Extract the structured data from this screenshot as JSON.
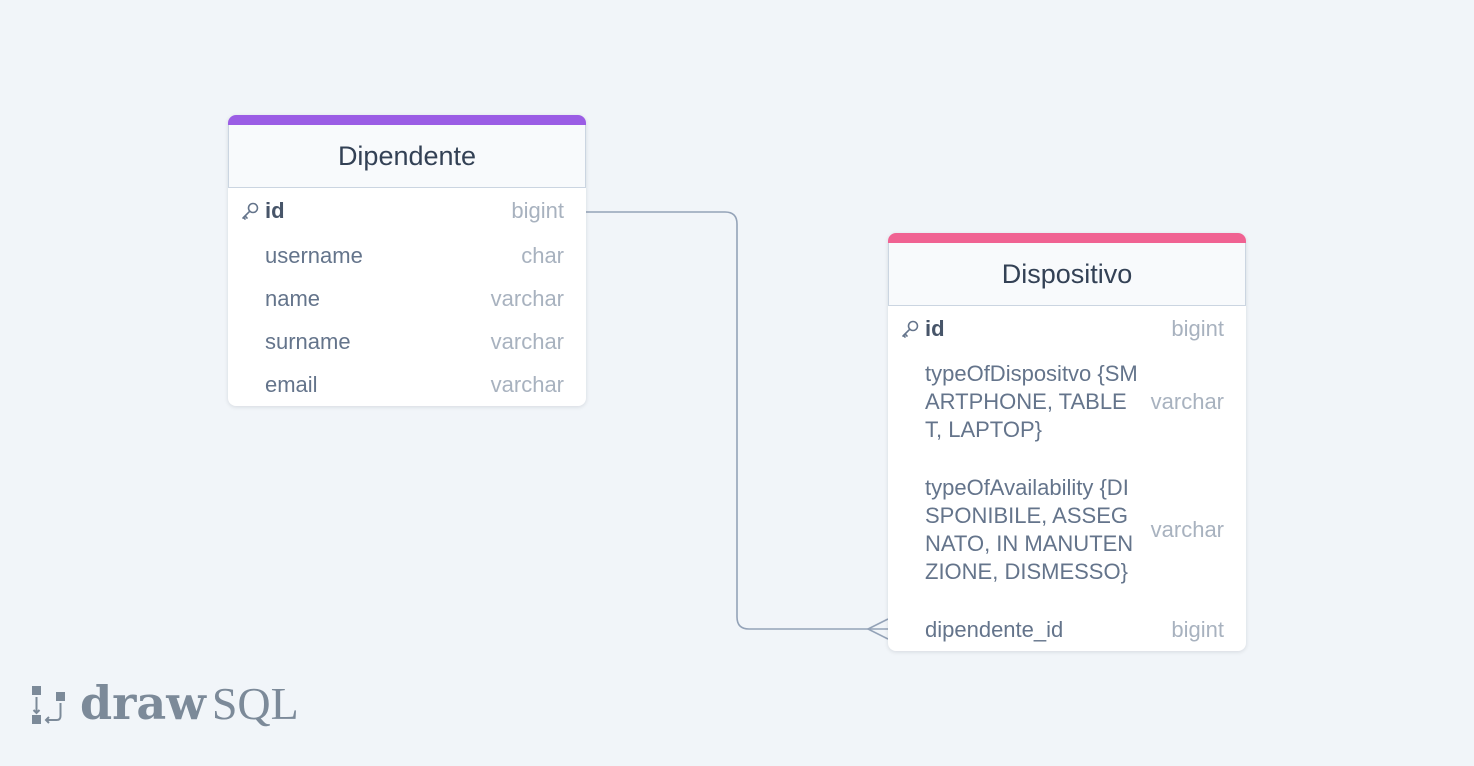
{
  "tables": [
    {
      "name": "Dipendente",
      "color": "#9b5de5",
      "columns": [
        {
          "name": "id",
          "type": "bigint",
          "primary_key": true
        },
        {
          "name": "username",
          "type": "char",
          "primary_key": false
        },
        {
          "name": "name",
          "type": "varchar",
          "primary_key": false
        },
        {
          "name": "surname",
          "type": "varchar",
          "primary_key": false
        },
        {
          "name": "email",
          "type": "varchar",
          "primary_key": false
        }
      ]
    },
    {
      "name": "Dispositivo",
      "color": "#f06292",
      "columns": [
        {
          "name": "id",
          "type": "bigint",
          "primary_key": true
        },
        {
          "name": "typeOfDispositvo {SMARTPHONE, TABLET, LAPTOP}",
          "type": "varchar",
          "primary_key": false
        },
        {
          "name": "typeOfAvailability {DISPONIBILE, ASSEGNATO, IN MANUTENZIONE, DISMESSO}",
          "type": "varchar",
          "primary_key": false
        },
        {
          "name": "dipendente_id",
          "type": "bigint",
          "primary_key": false
        }
      ]
    }
  ],
  "relationships": [
    {
      "from_table": "Dipendente",
      "from_column": "id",
      "to_table": "Dispositivo",
      "to_column": "dipendente_id",
      "cardinality": "one-to-many"
    }
  ],
  "logo": {
    "part1": "draw",
    "part2": "SQL"
  },
  "icons": {
    "primary_key": "key-icon",
    "logo_mark": "drawsql-logo-icon"
  }
}
